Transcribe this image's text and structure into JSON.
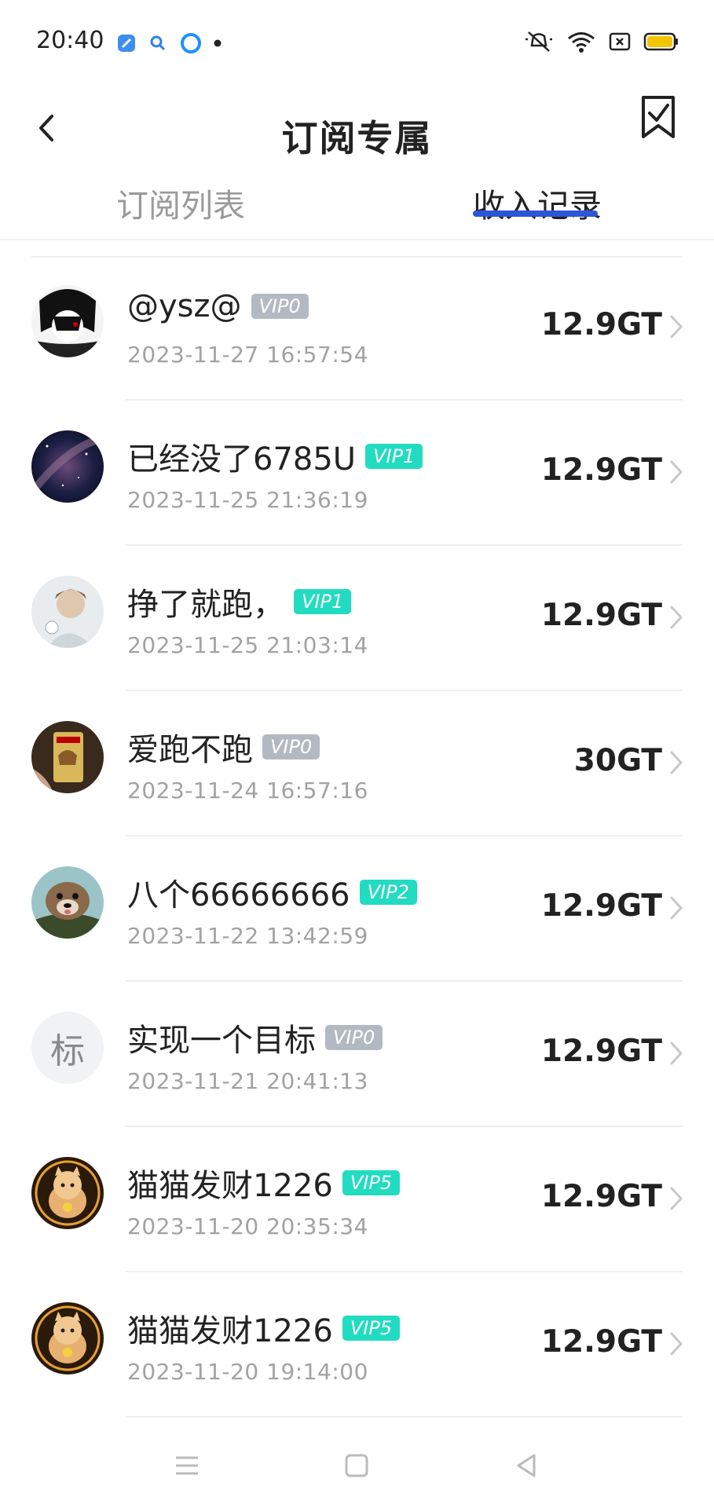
{
  "status_bar": {
    "time": "20:40"
  },
  "header": {
    "title": "订阅专属"
  },
  "tabs": [
    {
      "label": "订阅列表",
      "active": false
    },
    {
      "label": "收入记录",
      "active": true
    }
  ],
  "records": [
    {
      "name": "@ysz@",
      "vip": "VIP0",
      "time": "2023-11-27 16:57:54",
      "amount": "12.9GT"
    },
    {
      "name": "已经没了6785U",
      "vip": "VIP1",
      "time": "2023-11-25 21:36:19",
      "amount": "12.9GT"
    },
    {
      "name": "挣了就跑，",
      "vip": "VIP1",
      "time": "2023-11-25 21:03:14",
      "amount": "12.9GT"
    },
    {
      "name": "爱跑不跑",
      "vip": "VIP0",
      "time": "2023-11-24 16:57:16",
      "amount": "30GT"
    },
    {
      "name": "八个66666666",
      "vip": "VIP2",
      "time": "2023-11-22 13:42:59",
      "amount": "12.9GT"
    },
    {
      "name": "实现一个目标",
      "vip": "VIP0",
      "time": "2023-11-21 20:41:13",
      "amount": "12.9GT",
      "avatar_text": "标"
    },
    {
      "name": "猫猫发财1226",
      "vip": "VIP5",
      "time": "2023-11-20 20:35:34",
      "amount": "12.9GT"
    },
    {
      "name": "猫猫发财1226",
      "vip": "VIP5",
      "time": "2023-11-20 19:14:00",
      "amount": "12.9GT"
    }
  ],
  "colors": {
    "accent": "#2c56d8",
    "vip_green": "#21dcc0",
    "vip_grey": "#b3b9c3"
  }
}
